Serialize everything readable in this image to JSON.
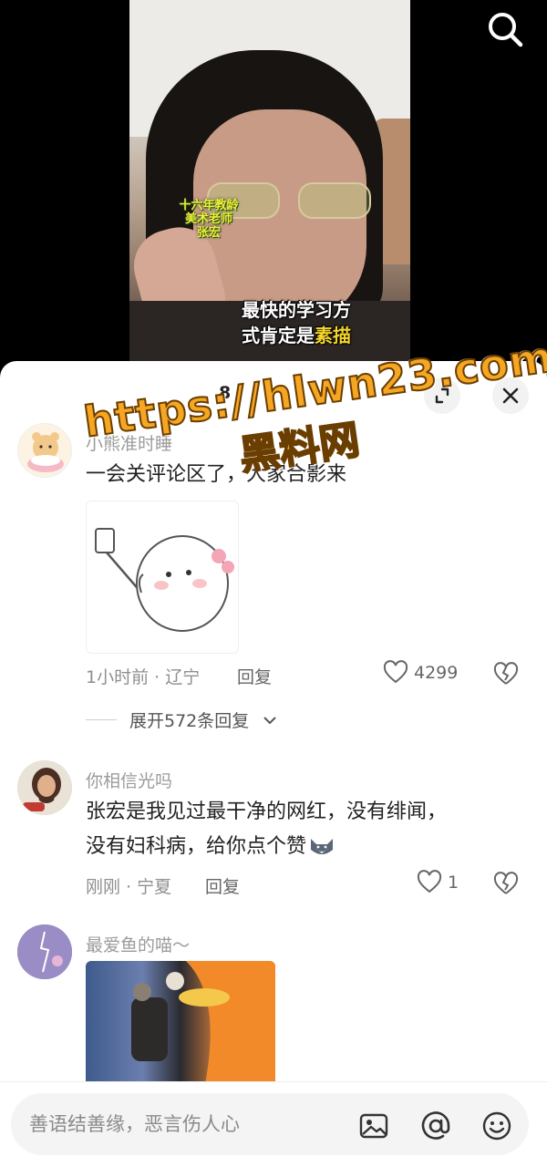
{
  "video": {
    "caption_small_lines": [
      "十六年教龄",
      "美术老师",
      "张宏"
    ],
    "caption_main_line1": "最快的学习方",
    "caption_main_line2_prefix": "式肯定是",
    "caption_main_highlight": "素描"
  },
  "search": {
    "icon": "search-icon"
  },
  "comments_panel": {
    "title": "8",
    "expand_icon": "expand-icon",
    "close_icon": "close-icon"
  },
  "comments": [
    {
      "username": "小熊准时睡",
      "text": "一会关评论区了，大家合影来",
      "meta": "1小时前 · 辽宁",
      "reply_label": "回复",
      "likes": "4299",
      "expand_replies": "展开572条回复"
    },
    {
      "username": "你相信光吗",
      "text_line1": "张宏是我见过最干净的网红，没有绯闻，",
      "text_line2": "没有妇科病，给你点个赞",
      "meta": "刚刚 · 宁夏",
      "reply_label": "回复",
      "likes": "1"
    },
    {
      "username": "最爱鱼的喵～"
    }
  ],
  "input": {
    "placeholder": "善语结善缘，恶言伤人心",
    "image_icon": "image-icon",
    "mention_icon": "at-icon",
    "emoji_icon": "emoji-icon"
  },
  "watermark": {
    "url": "https://hlwn23.com",
    "name": "黑料网"
  },
  "colors": {
    "watermark": "#f5a623",
    "caption_highlight": "#f4d52a",
    "caption_small": "#f4ef3a"
  }
}
